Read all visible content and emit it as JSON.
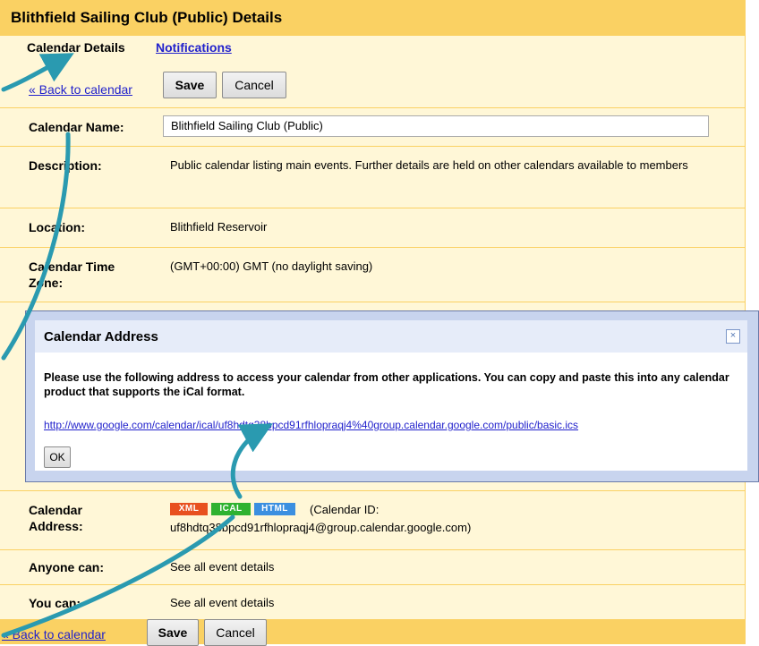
{
  "page": {
    "title": "Blithfield Sailing Club (Public) Details",
    "tabs": [
      {
        "label": "Calendar Details",
        "active": true
      },
      {
        "label": "Notifications",
        "active": false
      }
    ],
    "back_link": "« Back to calendar",
    "save_label": "Save",
    "cancel_label": "Cancel"
  },
  "fields": {
    "name_label": "Calendar Name:",
    "name_value": "Blithfield Sailing Club  (Public)",
    "description_label": "Description:",
    "description_value": "Public calendar listing main events. Further details are held on other calendars available to members",
    "location_label": "Location:",
    "location_value": "Blithfield Reservoir",
    "timezone_label_1": "Calendar Time",
    "timezone_label_2": "Zone:",
    "timezone_value": "(GMT+00:00) GMT (no daylight saving)",
    "address_label_1": "Calendar",
    "address_label_2": "Address:",
    "address_badges": {
      "xml": "XML",
      "ical": "ICAL",
      "html": "HTML"
    },
    "calendar_id_prefix": "(Calendar ID:",
    "calendar_id_value": "uf8hdtq38bpcd91rfhlopraqj4@group.calendar.google.com)",
    "anyone_label": "Anyone can:",
    "anyone_value": "See all event details",
    "you_label": "You can:",
    "you_value": "See all event details"
  },
  "dialog": {
    "title": "Calendar Address",
    "close_icon": "×",
    "message": "Please use the following address to access your calendar from other applications. You can copy and paste this into any calendar product that supports the iCal format.",
    "url": "http://www.google.com/calendar/ical/uf8hdtq38bpcd91rfhlopraqj4%40group.calendar.google.com/public/basic.ics",
    "ok_label": "OK"
  },
  "colors": {
    "header_yellow": "#fad163",
    "panel_cream": "#fff7d7",
    "link_blue": "#2222cc",
    "dialog_border": "#c8d4ee",
    "annotation_arrow": "#2a9ab0",
    "badge_xml": "#e8501f",
    "badge_ical": "#2fb230",
    "badge_html": "#3b8fe0"
  }
}
